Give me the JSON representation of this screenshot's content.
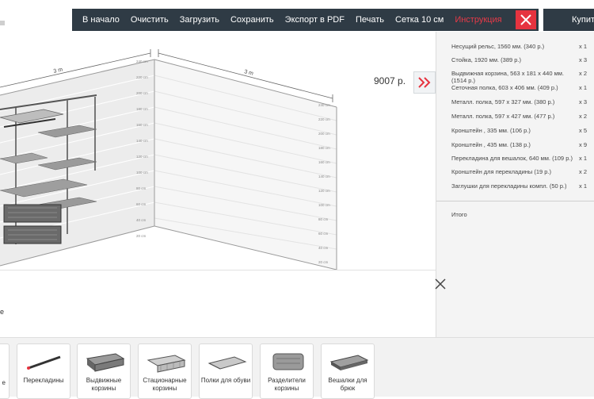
{
  "toolbar": {
    "items": [
      "В начало",
      "Очистить",
      "Загрузить",
      "Сохранить",
      "Экспорт в PDF",
      "Печать",
      "Сетка 10 см",
      "Инструкция"
    ],
    "buy": "Купить",
    "accent_color": "#e6333f",
    "bar_color": "#2f3b45"
  },
  "price": "9007 р.",
  "scene": {
    "dim_left": "3 m",
    "dim_right": "3 m",
    "ruler_left": [
      "240 cm",
      "220 cm",
      "200 cm",
      "180 cm",
      "160 cm",
      "140 cm",
      "120 cm",
      "100 cm",
      "80 cm",
      "60 cm",
      "40 cm",
      "20 cm"
    ],
    "ruler_right": [
      "240 cm",
      "220 cm",
      "200 cm",
      "180 cm",
      "160 cm",
      "140 cm",
      "120 cm",
      "100 cm",
      "80 cm",
      "60 cm",
      "40 cm",
      "20 cm"
    ]
  },
  "spec": {
    "items": [
      {
        "name": "Несущий рельс, 1560 мм. (340 р.)",
        "qty": "x 1"
      },
      {
        "name": "Стойка, 1920 мм. (389 р.)",
        "qty": "x 3"
      },
      {
        "name": "Выдвижная корзина, 563 x 181 x 440 мм. (1514 р.)",
        "qty": "x 2"
      },
      {
        "name": "Сеточная полка, 603 x 406 мм. (409 р.)",
        "qty": "x 1"
      },
      {
        "name": "Металл. полка, 597 x 327 мм. (380 р.)",
        "qty": "x 3"
      },
      {
        "name": "Металл. полка, 597 x 427 мм. (477 р.)",
        "qty": "x 2"
      },
      {
        "name": "Кронштейн , 335 мм. (106 р.)",
        "qty": "x 5"
      },
      {
        "name": "Кронштейн , 435 мм. (138 р.)",
        "qty": "x 9"
      },
      {
        "name": "Перекладина для вешалок, 640 мм. (109 р.)",
        "qty": "x 1"
      },
      {
        "name": "Кронштейн для перекладины (19 р.)",
        "qty": "x 2"
      },
      {
        "name": "Заглушки для перекладины компл. (50 р.)",
        "qty": "x 1"
      }
    ],
    "total_label": "Итого"
  },
  "lower": {
    "partial_text": "е"
  },
  "categories": {
    "partial_label": "е",
    "items": [
      {
        "label": "Перекладины",
        "icon": "rail-icon"
      },
      {
        "label": "Выдвижные корзины",
        "icon": "basket-icon"
      },
      {
        "label": "Стационарные корзины",
        "icon": "fixed-basket-icon"
      },
      {
        "label": "Полки для обуви",
        "icon": "shoe-shelf-icon"
      },
      {
        "label": "Разделители корзины",
        "icon": "divider-icon"
      },
      {
        "label": "Вешалки для брюк",
        "icon": "trouser-hanger-icon"
      }
    ]
  }
}
